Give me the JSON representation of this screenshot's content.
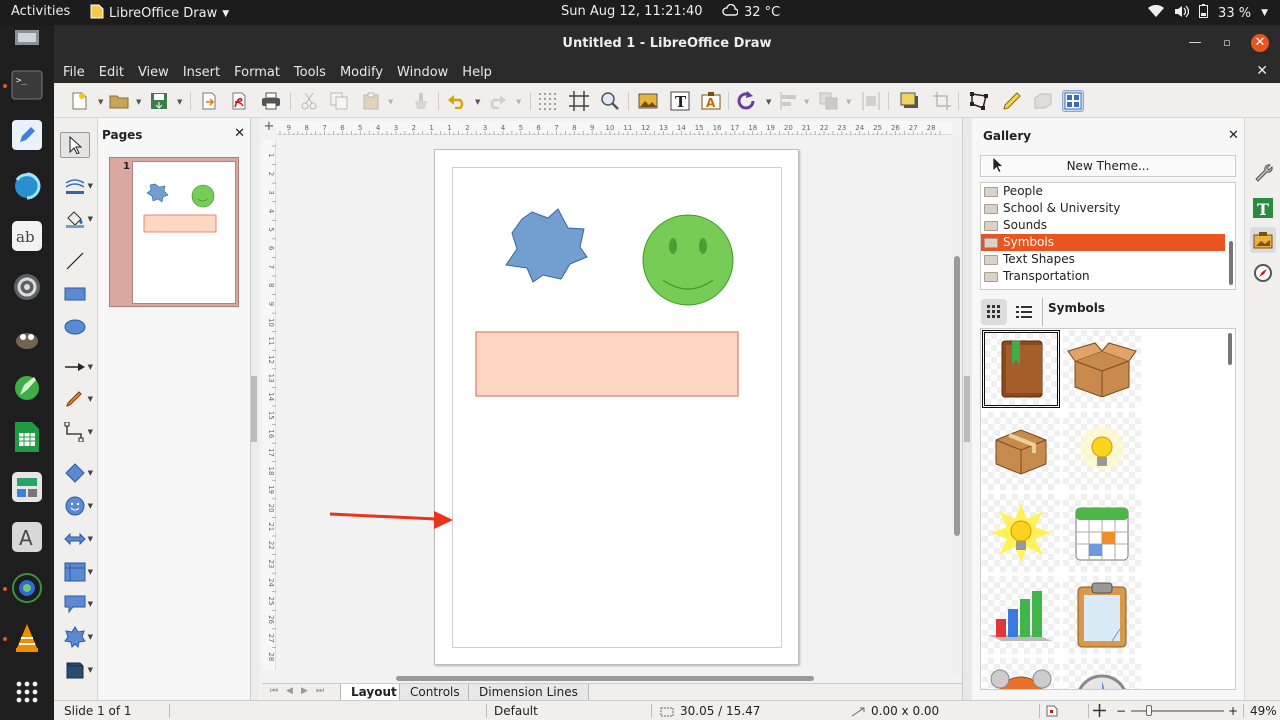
{
  "topbar": {
    "activities": "Activities",
    "app_name": "LibreOffice Draw",
    "clock": "Sun Aug 12, 11:21:40",
    "weather": "32 °C",
    "battery": "33 %"
  },
  "window": {
    "title": "Untitled 1 - LibreOffice Draw"
  },
  "menu": [
    "File",
    "Edit",
    "View",
    "Insert",
    "Format",
    "Tools",
    "Modify",
    "Window",
    "Help"
  ],
  "pages_pane": {
    "title": "Pages",
    "page_number": "1"
  },
  "gallery": {
    "title": "Gallery",
    "new_theme_label": "New Theme...",
    "themes": [
      "People",
      "School & University",
      "Sounds",
      "Symbols",
      "Text Shapes",
      "Transportation"
    ],
    "selected_theme": "Symbols",
    "current_theme_title": "Symbols",
    "items": [
      "book-icon",
      "open-box-icon",
      "package-icon",
      "light-bulb-icon",
      "glowing-bulb-icon",
      "calendar-icon",
      "bar-chart-icon",
      "clipboard-icon",
      "alarm-clock-icon",
      "compass-icon"
    ]
  },
  "tabs": [
    "Layout",
    "Controls",
    "Dimension Lines"
  ],
  "active_tab": "Layout",
  "statusbar": {
    "slide": "Slide 1 of 1",
    "master": "Default",
    "position": "30.05 / 15.47",
    "size": "0.00 x 0.00",
    "zoom": "49%"
  },
  "ruler": {
    "h_labels": [
      "9",
      "8",
      "7",
      "6",
      "5",
      "4",
      "3",
      "2",
      "1",
      "1",
      "2",
      "3",
      "4",
      "5",
      "6",
      "7",
      "8",
      "9",
      "10",
      "11",
      "12",
      "13",
      "14",
      "15",
      "16",
      "17",
      "18",
      "19",
      "20",
      "21",
      "22",
      "23",
      "24",
      "25",
      "26",
      "27",
      "28"
    ],
    "v_labels": [
      "1",
      "2",
      "3",
      "4",
      "5",
      "6",
      "7",
      "8",
      "9",
      "10",
      "11",
      "12",
      "13",
      "14",
      "15",
      "16",
      "17",
      "18",
      "19",
      "20",
      "21",
      "22",
      "23",
      "24",
      "25",
      "26",
      "27",
      "28"
    ]
  },
  "colors": {
    "accent": "#e95420",
    "star_fill": "#729fcf",
    "smiley_fill": "#77cc55",
    "rect_fill": "#ffd7c3",
    "arrow": "#e8341c"
  }
}
